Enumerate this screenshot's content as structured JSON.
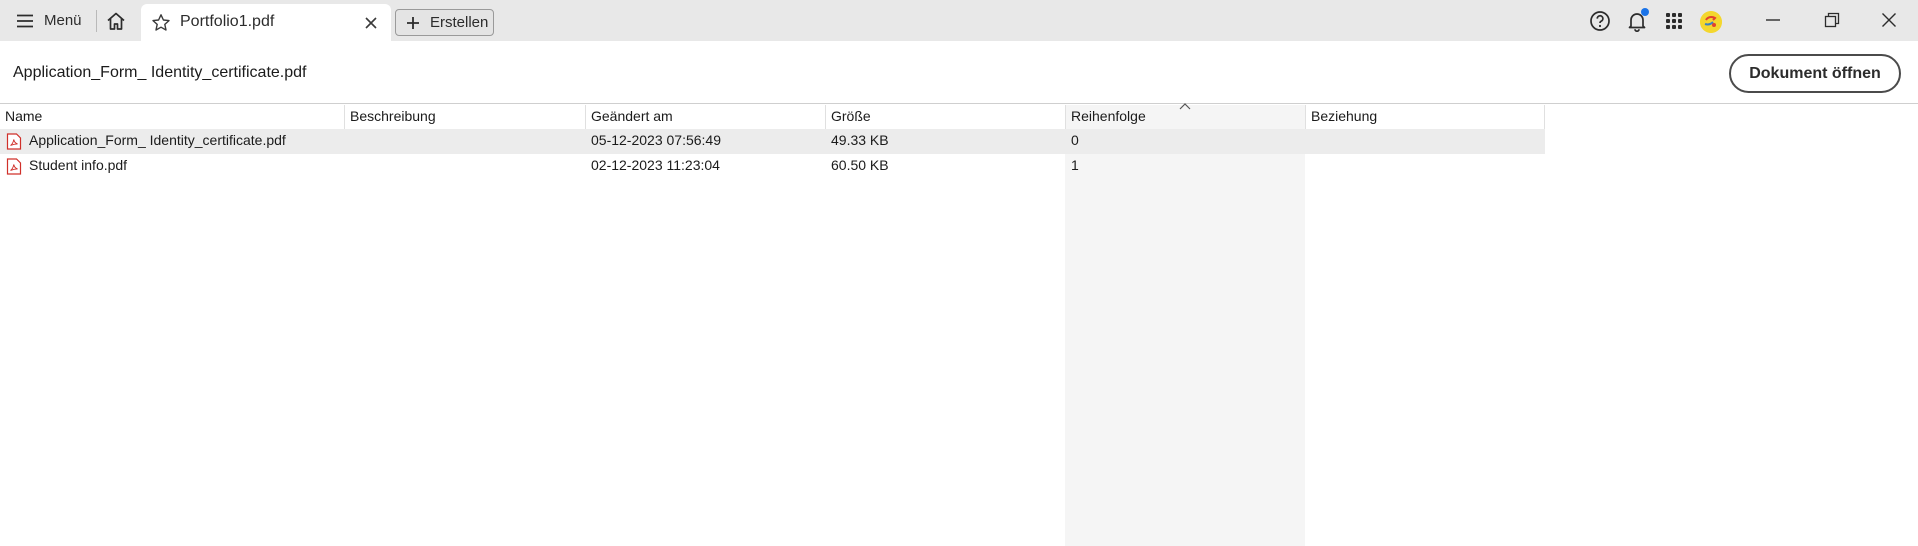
{
  "titlebar": {
    "menu_label": "Menü",
    "tab_title": "Portfolio1.pdf",
    "create_label": "Erstellen",
    "notification_dot_color": "#1a73e8",
    "icons": [
      "hamburger-icon",
      "home-icon",
      "star-icon",
      "close-icon",
      "plus-icon",
      "help-icon",
      "bell-icon",
      "apps-grid-icon",
      "avatar",
      "minimize-icon",
      "restore-icon",
      "window-close-icon"
    ]
  },
  "document": {
    "selected_file": "Application_Form_ Identity_certificate.pdf",
    "open_button": "Dokument öffnen"
  },
  "table": {
    "columns": [
      "Name",
      "Beschreibung",
      "Geändert am",
      "Größe",
      "Reihenfolge",
      "Beziehung"
    ],
    "sorted_column": "Reihenfolge",
    "sort_direction": "ascending",
    "rows": [
      {
        "name": "Application_Form_ Identity_certificate.pdf",
        "description": "",
        "modified": "05-12-2023 07:56:49",
        "size": "49.33 KB",
        "order": "0",
        "relation": "",
        "selected": true
      },
      {
        "name": "Student info.pdf",
        "description": "",
        "modified": "02-12-2023 11:23:04",
        "size": "60.50 KB",
        "order": "1",
        "relation": "",
        "selected": false
      }
    ]
  }
}
